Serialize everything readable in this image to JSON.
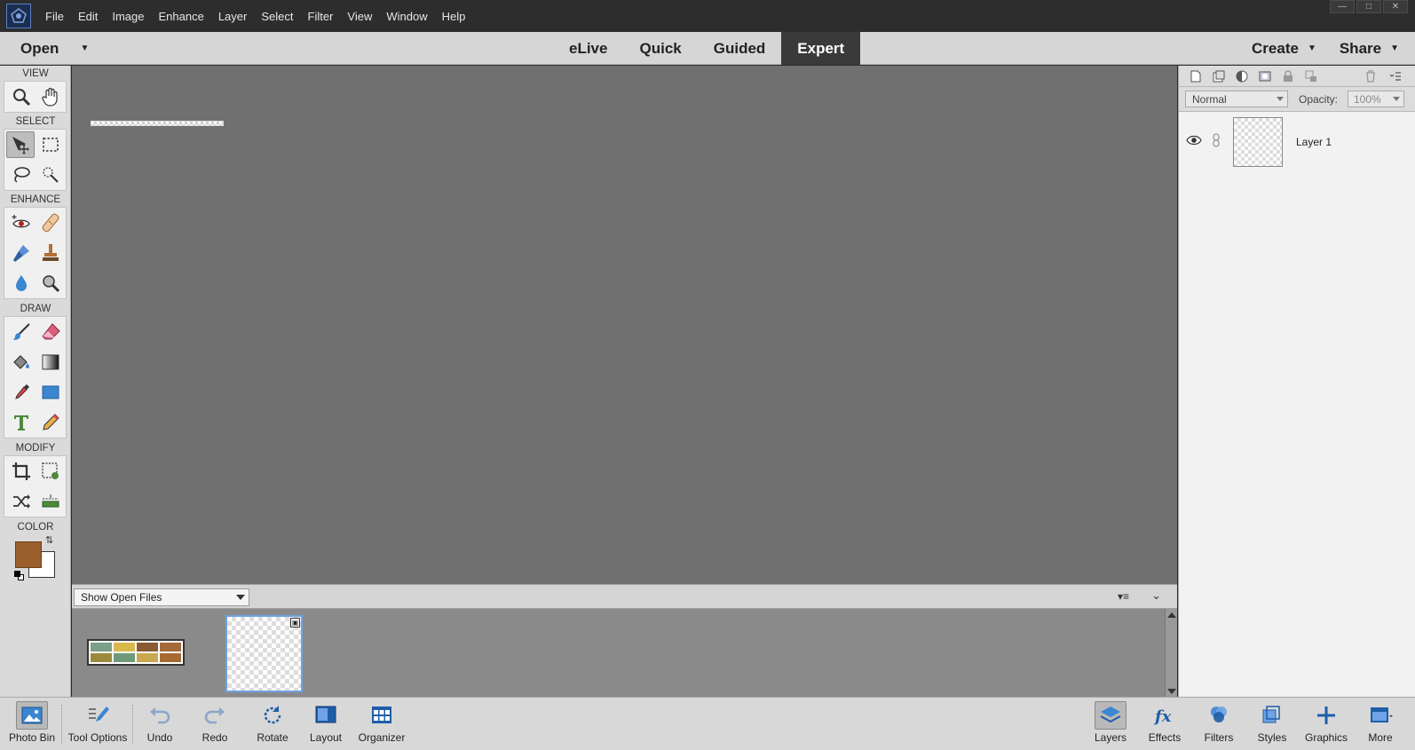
{
  "menubar": {
    "items": [
      "File",
      "Edit",
      "Image",
      "Enhance",
      "Layer",
      "Select",
      "Filter",
      "View",
      "Window",
      "Help"
    ]
  },
  "modebar": {
    "open_label": "Open",
    "tabs": [
      {
        "label": "eLive",
        "active": false
      },
      {
        "label": "Quick",
        "active": false
      },
      {
        "label": "Guided",
        "active": false
      },
      {
        "label": "Expert",
        "active": true
      }
    ],
    "create_label": "Create",
    "share_label": "Share"
  },
  "toolbox": {
    "sections": {
      "view": "VIEW",
      "select": "SELECT",
      "enhance": "ENHANCE",
      "draw": "DRAW",
      "modify": "MODIFY",
      "color": "COLOR"
    },
    "foreground_color": "#9a5f2c",
    "background_color": "#ffffff"
  },
  "photo_bin": {
    "dropdown_value": "Show Open Files",
    "palette_colors": [
      "#7aa08a",
      "#d9b84e",
      "#8b5a35",
      "#a36a3a",
      "#9b8a3c",
      "#6f9a7a",
      "#c9a850",
      "#a56b33"
    ]
  },
  "layers_panel": {
    "blend_mode": "Normal",
    "opacity_label": "Opacity:",
    "opacity_value": "100%",
    "layers": [
      {
        "name": "Layer 1"
      }
    ]
  },
  "bottombar": {
    "photo_bin": "Photo Bin",
    "tool_options": "Tool Options",
    "undo": "Undo",
    "redo": "Redo",
    "rotate": "Rotate",
    "layout": "Layout",
    "organizer": "Organizer",
    "layers": "Layers",
    "effects": "Effects",
    "filters": "Filters",
    "styles": "Styles",
    "graphics": "Graphics",
    "more": "More"
  },
  "colors": {
    "accent": "#6fa2e6",
    "active_tab": "#3a3a3a"
  }
}
